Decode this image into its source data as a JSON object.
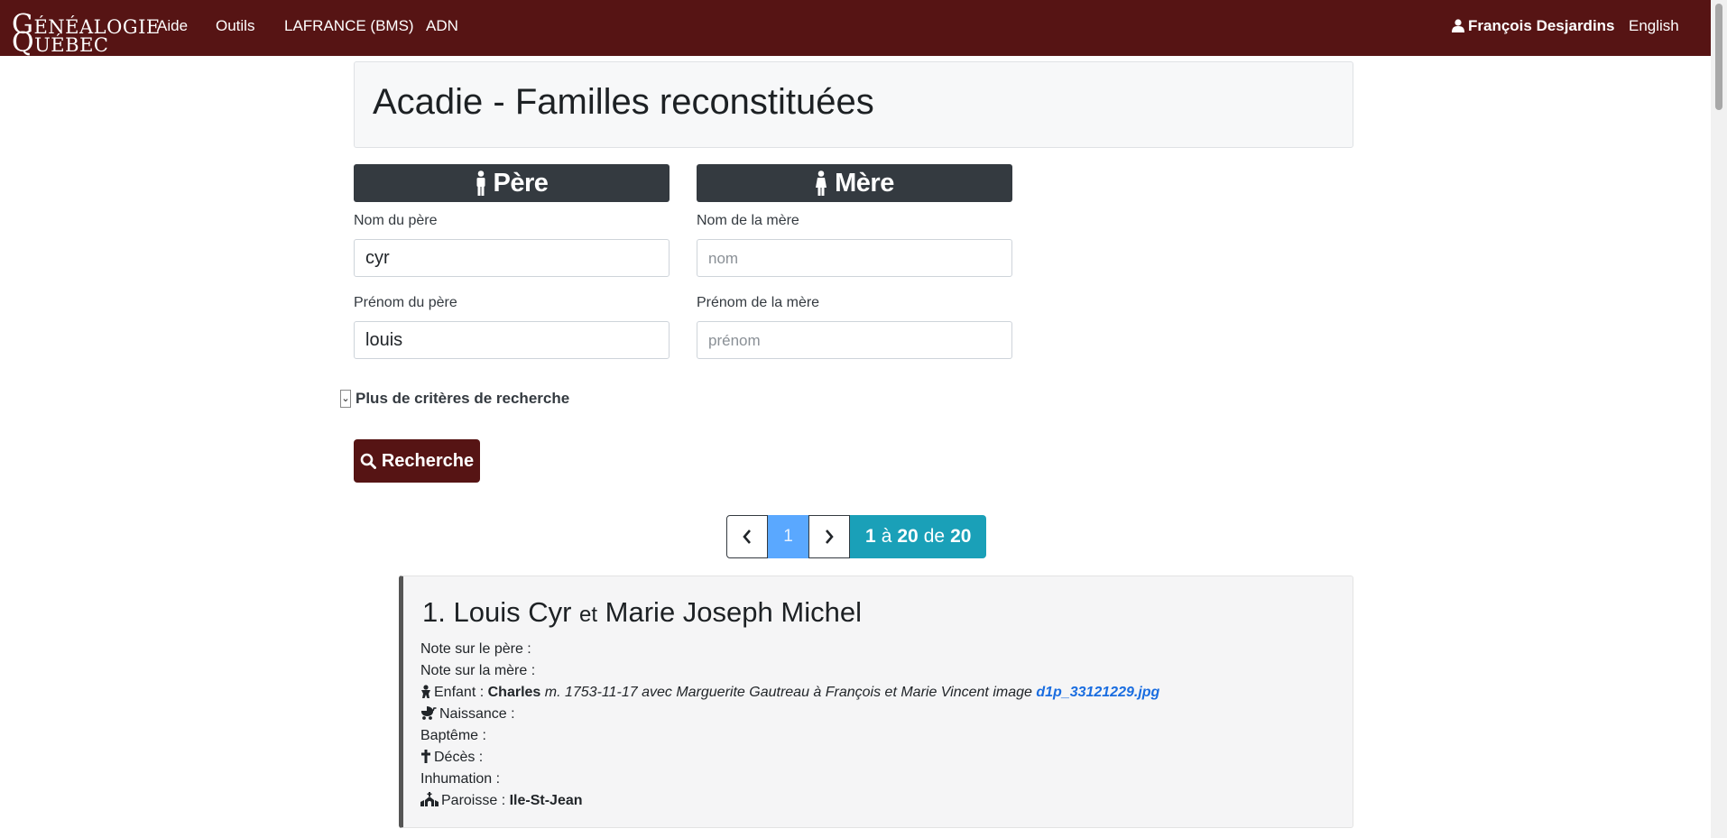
{
  "nav": {
    "logo_line1_cap": "G",
    "logo_line1_rest": "ÉNÉALOGIE",
    "logo_line2_cap": "Q",
    "logo_line2_rest": "UÉBEC",
    "links": [
      "Aide",
      "Outils",
      "LAFRANCE (BMS)",
      "ADN"
    ],
    "user": "François Desjardins",
    "language": "English"
  },
  "page": {
    "title": "Acadie - Familles reconstituées"
  },
  "father": {
    "header": "Père",
    "surname_label": "Nom du père",
    "surname_value": "cyr",
    "firstname_label": "Prénom du père",
    "firstname_value": "louis"
  },
  "mother": {
    "header": "Mère",
    "surname_label": "Nom de la mère",
    "surname_placeholder": "nom",
    "firstname_label": "Prénom de la mère",
    "firstname_placeholder": "prénom"
  },
  "more_criteria": "Plus de critères de recherche",
  "search_button": "Recherche",
  "pagination": {
    "current_page": "1",
    "range_from": "1",
    "range_word": "à",
    "range_to": "20",
    "of_word": "de",
    "total": "20"
  },
  "result": {
    "title_prefix": "1. Louis Cyr",
    "title_et": "et",
    "title_suffix": "Marie Joseph Michel",
    "note_father": "Note sur le père :",
    "note_mother": "Note sur la mère :",
    "child_label": "Enfant :",
    "child_name": "Charles",
    "child_detail": "m. 1753-11-17 avec Marguerite Gautreau à François et Marie Vincent image",
    "child_link": "d1p_33121229.jpg",
    "birth_label": "Naissance :",
    "baptism_label": "Baptême :",
    "death_label": "Décès :",
    "burial_label": "Inhumation :",
    "parish_label": "Paroisse :",
    "parish_value": "Ile-St-Jean"
  },
  "colors": {
    "navbar": "#561414",
    "header_dark": "#343a40",
    "page_active": "#5aa8ff",
    "range_badge": "#1aa0b8",
    "link": "#1a6de0"
  }
}
